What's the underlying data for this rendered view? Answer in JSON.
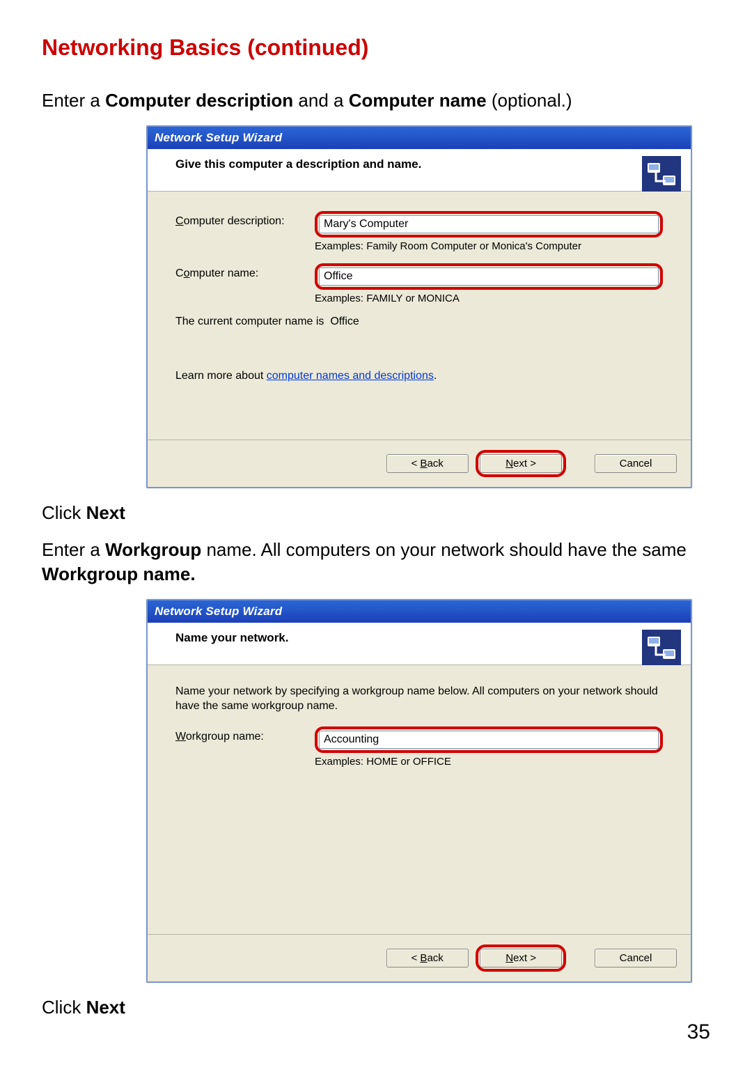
{
  "page": {
    "heading": "Networking Basics (continued)",
    "pageNumber": "35",
    "intro1_pre": "Enter a ",
    "intro1_b1": "Computer description",
    "intro1_mid": " and a ",
    "intro1_b2": "Computer name",
    "intro1_post": " (optional.)",
    "clickNext_pre": "Click ",
    "clickNext_bold": "Next",
    "intro2_pre": "Enter a ",
    "intro2_b1": "Workgroup",
    "intro2_mid": " name.  All computers on your network should have the same ",
    "intro2_b2": "Workgroup name."
  },
  "wizard1": {
    "title": "Network Setup Wizard",
    "header": "Give this computer a description and name.",
    "descLabel_ul": "C",
    "descLabel_rest": "omputer description:",
    "descValue": "Mary's Computer",
    "descExample": "Examples: Family Room Computer or Monica's Computer",
    "nameLabel_pre": "C",
    "nameLabel_ul": "o",
    "nameLabel_rest": "mputer name:",
    "nameValue": "Office",
    "nameExample": "Examples: FAMILY or MONICA",
    "currentName_pre": "The current computer name is ",
    "currentName_val": "Office",
    "learnMore_pre": "Learn more about ",
    "learnMore_link": "computer names and descriptions",
    "learnMore_post": ".",
    "back_pre": "< ",
    "back_ul": "B",
    "back_rest": "ack",
    "next_ul": "N",
    "next_rest": "ext >",
    "cancel": "Cancel"
  },
  "wizard2": {
    "title": "Network Setup Wizard",
    "header": "Name your network.",
    "desc": "Name your network by specifying a workgroup name below. All computers on your network should have the same workgroup name.",
    "wgLabel_ul": "W",
    "wgLabel_rest": "orkgroup name:",
    "wgValue": "Accounting",
    "wgExample": "Examples: HOME or OFFICE",
    "back_pre": "< ",
    "back_ul": "B",
    "back_rest": "ack",
    "next_ul": "N",
    "next_rest": "ext >",
    "cancel": "Cancel"
  }
}
